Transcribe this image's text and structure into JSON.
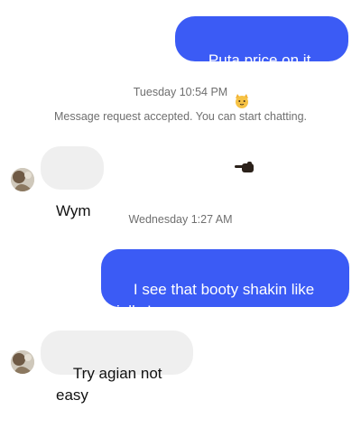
{
  "messages": {
    "m1": {
      "text": "Puta price on it",
      "icons": [
        "cat-face-icon",
        "pointing-left-icon"
      ]
    },
    "ts1": "Tuesday 10:54 PM",
    "system_note": "Message request accepted. You can start chatting.",
    "m2": {
      "text": "Wym"
    },
    "ts2": "Wednesday 1:27 AM",
    "m3": {
      "text": "I see that booty shakin like jelly I wanna see mo"
    },
    "m4": {
      "text": "Try agian not easy"
    }
  },
  "colors": {
    "outgoing_bubble": "#3b5bf5",
    "incoming_bubble": "#efefef",
    "meta_text": "#6f6f6f"
  }
}
